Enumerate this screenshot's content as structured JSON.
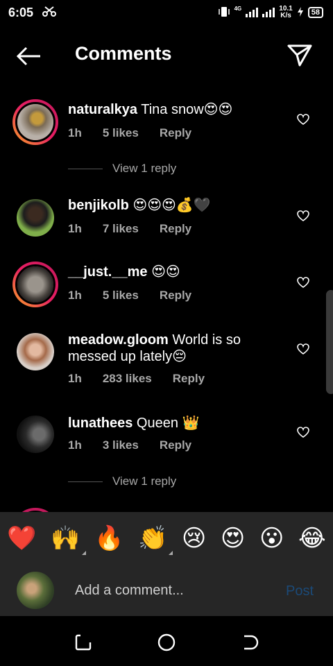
{
  "status": {
    "time": "6:05",
    "network_label": "4G",
    "speed_value": "10.1",
    "speed_unit": "K/s",
    "battery": "58"
  },
  "header": {
    "title": "Comments",
    "back_icon": "arrow-left-icon",
    "share_icon": "paper-plane-icon"
  },
  "comments": [
    {
      "username": "naturalkya",
      "text": "Tina snow😍😍",
      "time": "1h",
      "likes": "5 likes",
      "reply": "Reply",
      "view_replies": "View 1 reply"
    },
    {
      "username": "benjikolb",
      "text": "😍😍😍💰🖤",
      "time": "1h",
      "likes": "7 likes",
      "reply": "Reply"
    },
    {
      "username": "__just.__me",
      "text": "😍😍",
      "time": "1h",
      "likes": "5 likes",
      "reply": "Reply"
    },
    {
      "username": "meadow.gloom",
      "text": "World is so messed up lately😔",
      "time": "1h",
      "likes": "283 likes",
      "reply": "Reply"
    },
    {
      "username": "lunathees",
      "text": "Queen 👑",
      "time": "1h",
      "likes": "3 likes",
      "reply": "Reply",
      "view_replies": "View 1 reply"
    }
  ],
  "emoji_bar": [
    "❤️",
    "🙌",
    "🔥",
    "👏",
    "😢",
    "😍",
    "😮",
    "😂"
  ],
  "composer": {
    "placeholder": "Add a comment...",
    "post_label": "Post"
  },
  "colors": {
    "background": "#000000",
    "panel": "#262626",
    "muted_text": "#a8a8a8",
    "post_disabled": "#1b4a78",
    "story_ring_start": "#f9a825",
    "story_ring_end": "#c2185b"
  }
}
